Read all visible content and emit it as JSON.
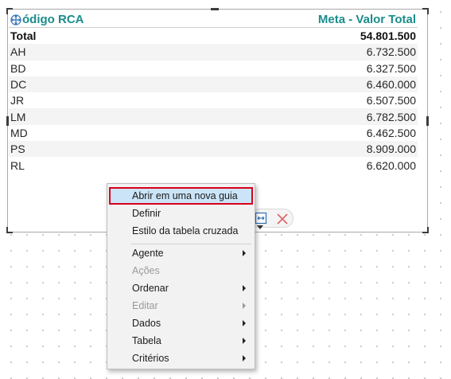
{
  "table": {
    "col1_header": "ódigo RCA",
    "col2_header": "Meta - Valor Total",
    "total": {
      "label": "Total",
      "value": "54.801.500"
    },
    "rows": [
      {
        "label": "AH",
        "value": "6.732.500"
      },
      {
        "label": "BD",
        "value": "6.327.500"
      },
      {
        "label": "DC",
        "value": "6.460.000"
      },
      {
        "label": "JR",
        "value": "6.507.500"
      },
      {
        "label": "LM",
        "value": "6.782.500"
      },
      {
        "label": "MD",
        "value": "6.462.500"
      },
      {
        "label": "PS",
        "value": "8.909.000"
      },
      {
        "label": "RL",
        "value": "6.620.000"
      }
    ]
  },
  "mini_toolbar": {
    "icons": [
      "expand-icon",
      "dropdown-caret-icon",
      "close-icon"
    ]
  },
  "context_menu": {
    "items": [
      {
        "label": "Abrir em uma nova guia",
        "highlighted": true
      },
      {
        "label": "Definir"
      },
      {
        "label": "Estilo da tabela cruzada"
      },
      {
        "label": "Agente",
        "submenu": true
      },
      {
        "label": "Ações",
        "disabled": true
      },
      {
        "label": "Ordenar",
        "submenu": true
      },
      {
        "label": "Editar",
        "submenu": true,
        "disabled": true
      },
      {
        "label": "Dados",
        "submenu": true
      },
      {
        "label": "Tabela",
        "submenu": true
      },
      {
        "label": "Critérios",
        "submenu": true
      }
    ]
  },
  "colors": {
    "header_text": "#1b8c8c",
    "highlight_bg": "#cce4f7",
    "highlight_border": "#d9001b",
    "close_icon": "#e06464",
    "expand_icon": "#2f6fb5"
  }
}
